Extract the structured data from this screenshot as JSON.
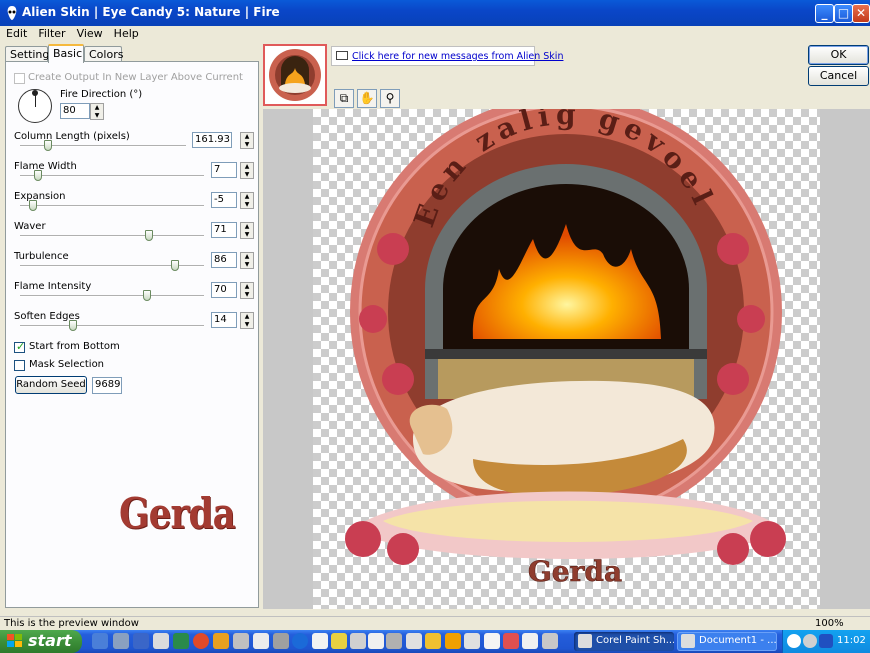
{
  "window": {
    "title": "Alien Skin | Eye Candy 5: Nature | Fire"
  },
  "menu": [
    "Edit",
    "Filter",
    "View",
    "Help"
  ],
  "tabs": [
    "Settings",
    "Basic",
    "Colors"
  ],
  "active_tab": "Basic",
  "basic": {
    "create_output_label": "Create Output In New Layer Above Current",
    "create_output_checked": false,
    "fire_direction": {
      "label": "Fire Direction (°)",
      "value": "80"
    },
    "column_length": {
      "label": "Column Length (pixels)",
      "value": "161.93",
      "fraction": 0.15
    },
    "flame_width": {
      "label": "Flame Width",
      "value": "7",
      "fraction": 0.08
    },
    "expansion": {
      "label": "Expansion",
      "value": "-5",
      "fraction": 0.05
    },
    "waver": {
      "label": "Waver",
      "value": "71",
      "fraction": 0.71
    },
    "turbulence": {
      "label": "Turbulence",
      "value": "86",
      "fraction": 0.86
    },
    "flame_intensity": {
      "label": "Flame Intensity",
      "value": "70",
      "fraction": 0.7
    },
    "soften_edges": {
      "label": "Soften Edges",
      "value": "14",
      "fraction": 0.28
    },
    "start_from_bottom": {
      "label": "Start from Bottom",
      "checked": true
    },
    "mask_selection": {
      "label": "Mask Selection",
      "checked": false
    },
    "random_seed": {
      "button": "Random Seed",
      "value": "9689"
    }
  },
  "signature": "Gerda",
  "preview": {
    "arc_text": "Een zalig gevoel",
    "bottom_text": "Gerda"
  },
  "messages_link": "Click here for new messages from Alien Skin",
  "buttons": {
    "ok": "OK",
    "cancel": "Cancel"
  },
  "status": {
    "left": "This is the preview window",
    "zoom": "100%"
  },
  "taskbar": {
    "start": "start",
    "tasks": [
      "Corel Paint Sh...",
      "Document1 - ..."
    ],
    "clock": "11:02"
  }
}
